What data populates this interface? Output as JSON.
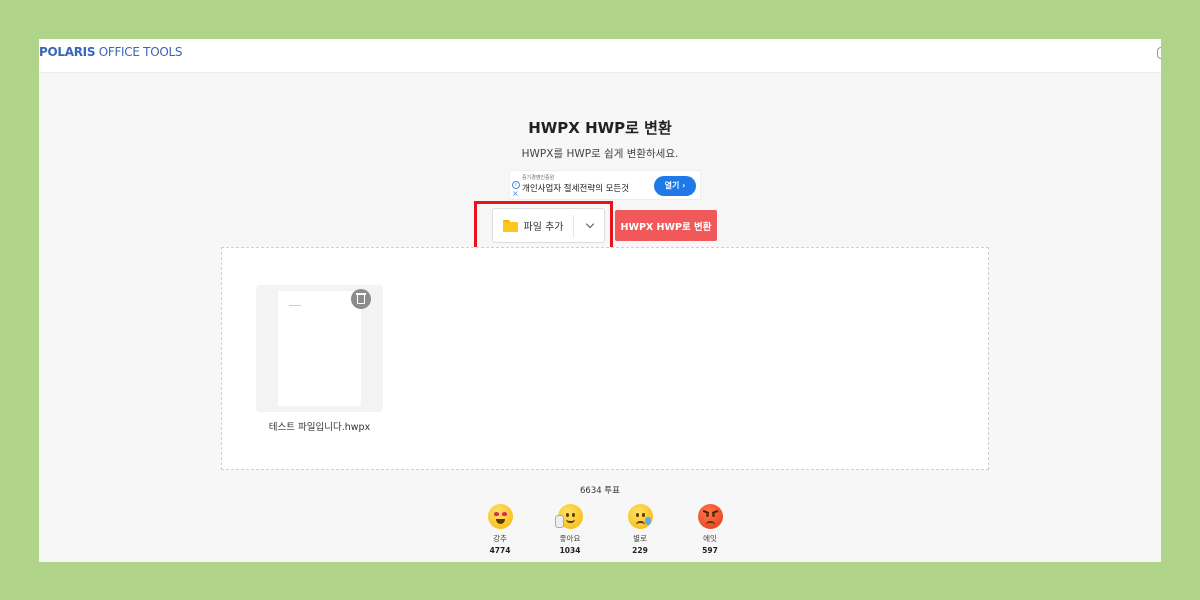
{
  "header": {
    "logo_brand": "POLARIS",
    "logo_suffix": " OFFICE TOOLS"
  },
  "main": {
    "title": "HWPX HWP로 변환",
    "subtitle": "HWPX를 HWP로 쉽게 변환하세요."
  },
  "ad": {
    "sponsor": "중기경영인증원",
    "text": "개인사업자 절세전략의 모든것",
    "button_label": "열기 ›",
    "info_icon": "info-icon",
    "close_icon": "close-icon"
  },
  "toolbar": {
    "add_file_label": "파일 추가",
    "folder_icon": "folder-icon",
    "dropdown_icon": "chevron-down-icon",
    "convert_label": "HWPX HWP로 변환",
    "accent_color": "#f0585a",
    "highlight_color": "#e8141a"
  },
  "files": [
    {
      "name": "테스트 파일입니다.hwpx",
      "delete_icon": "trash-icon"
    }
  ],
  "votes": {
    "total_label": "6634 투표",
    "reactions": [
      {
        "label": "강추",
        "count": "4774",
        "icon": "heart-eyes-emoji-icon"
      },
      {
        "label": "좋아요",
        "count": "1034",
        "icon": "thumbs-up-emoji-icon"
      },
      {
        "label": "별로",
        "count": "229",
        "icon": "sad-tear-emoji-icon"
      },
      {
        "label": "에잇",
        "count": "597",
        "icon": "angry-emoji-icon"
      }
    ]
  }
}
